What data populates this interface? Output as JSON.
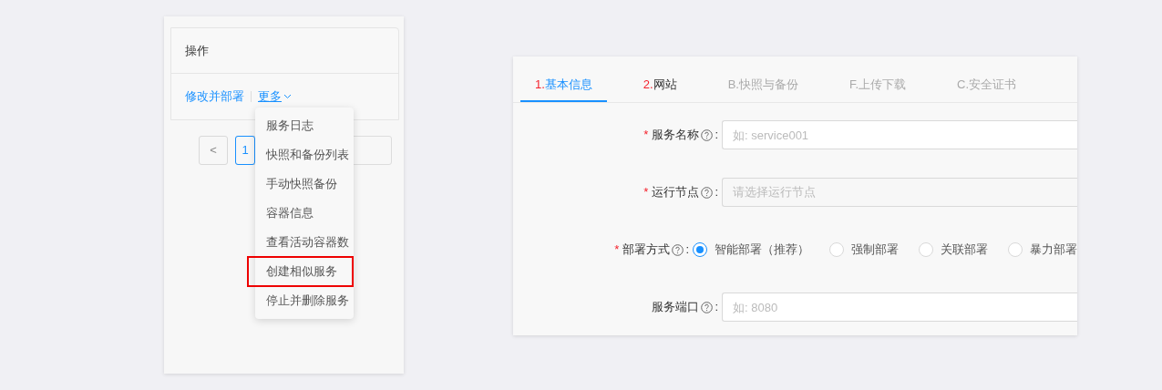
{
  "left_panel": {
    "table": {
      "header": "操作",
      "actions": [
        {
          "label": "修改并部署",
          "kind": "link"
        },
        {
          "label": "更多",
          "kind": "dropdown"
        }
      ]
    },
    "pagination": {
      "prev": "<",
      "page": "1"
    },
    "menu": [
      {
        "label": "服务日志",
        "outlined": false
      },
      {
        "label": "快照和备份列表",
        "outlined": false
      },
      {
        "label": "手动快照备份",
        "outlined": false
      },
      {
        "label": "容器信息",
        "outlined": false
      },
      {
        "label": "查看活动容器数",
        "outlined": false
      },
      {
        "label": "创建相似服务",
        "outlined": true
      },
      {
        "label": "停止并删除服务",
        "outlined": false
      }
    ]
  },
  "right_panel": {
    "tabs": [
      {
        "number": "1.",
        "label": "基本信息",
        "selected": true,
        "disabled": false
      },
      {
        "number": "2.",
        "label": "网站",
        "selected": false,
        "disabled": false
      },
      {
        "label": "B.快照与备份",
        "selected": false,
        "disabled": true
      },
      {
        "label": "F.上传下载",
        "selected": false,
        "disabled": true
      },
      {
        "label": "C.安全证书",
        "selected": false,
        "disabled": true
      }
    ],
    "fields": [
      {
        "kind": "input",
        "required_mark": "*",
        "label": "服务名称",
        "colon": ":",
        "placeholder": "如: service001"
      },
      {
        "kind": "select",
        "required_mark": "*",
        "label": "运行节点",
        "colon": ":",
        "placeholder": "请选择运行节点"
      },
      {
        "kind": "radio",
        "required_mark": "*",
        "label": "部署方式",
        "colon": ":",
        "options": [
          {
            "label": "智能部署（推荐）",
            "selected": true
          },
          {
            "label": "强制部署",
            "selected": false
          },
          {
            "label": "关联部署",
            "selected": false
          },
          {
            "label": "暴力部署",
            "selected": false
          }
        ]
      },
      {
        "kind": "input",
        "label": "服务端口",
        "colon": ":",
        "placeholder": "如: 8080"
      }
    ]
  }
}
